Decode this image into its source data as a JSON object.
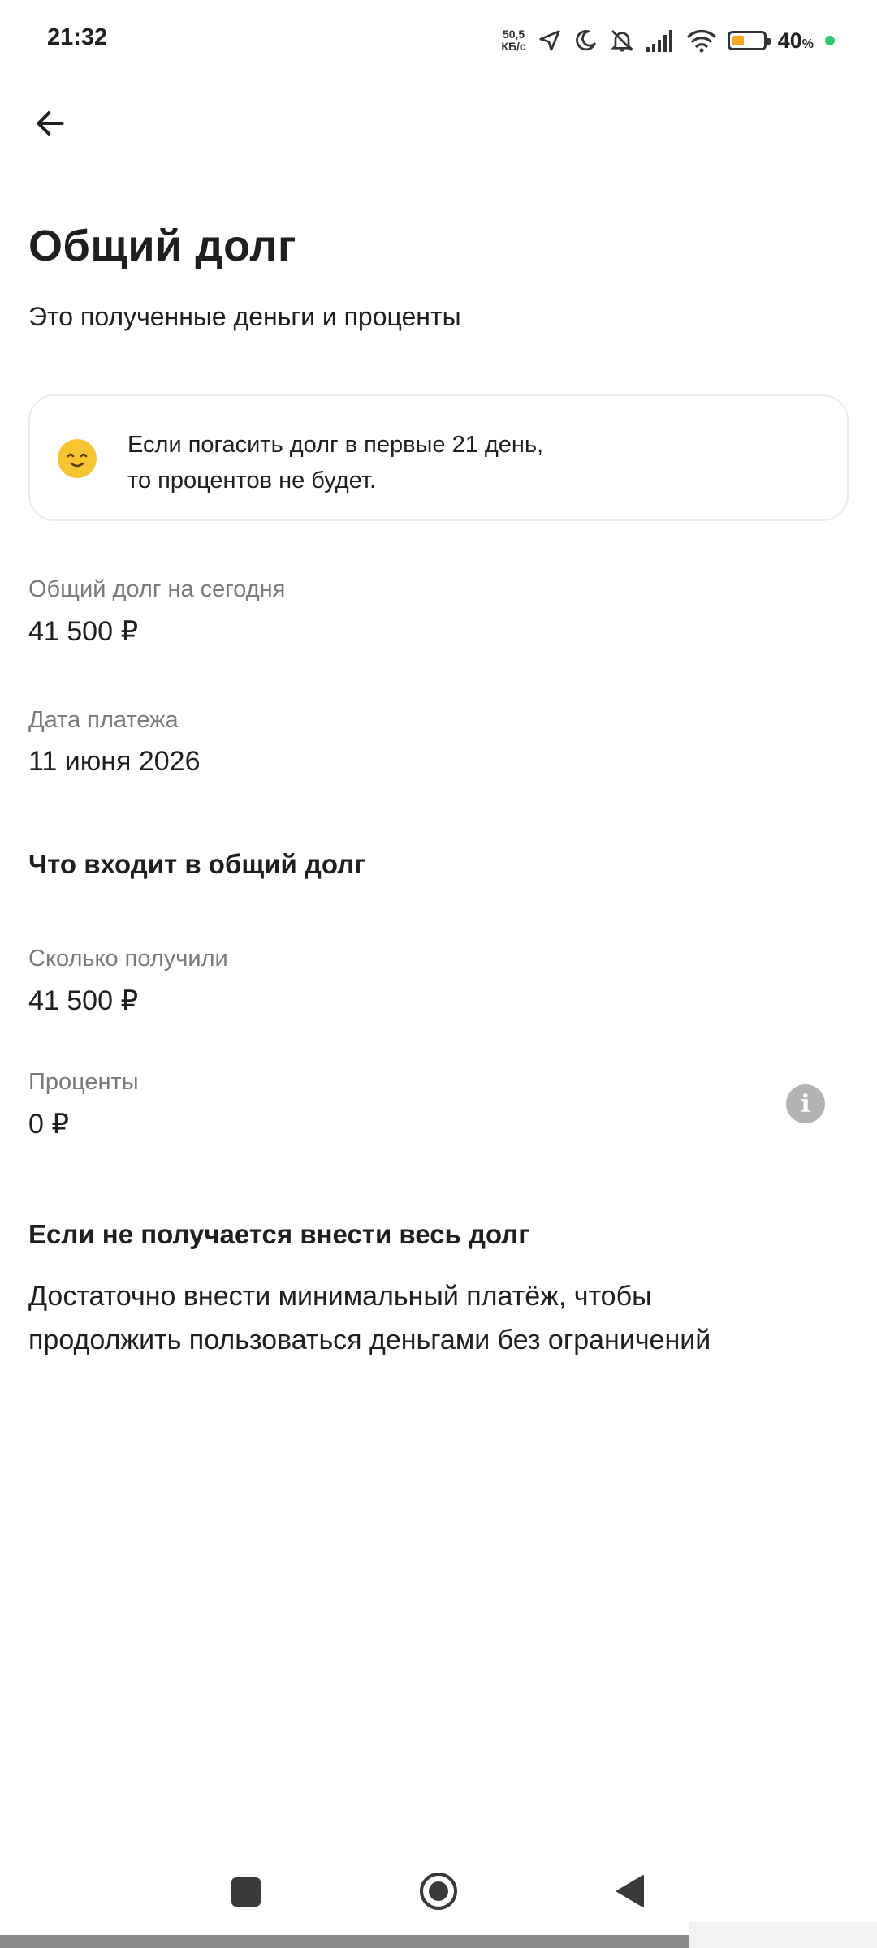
{
  "status_bar": {
    "time": "21:32",
    "net_speed_value": "50,5",
    "net_speed_unit": "КБ/с",
    "battery_percent": "40",
    "battery_percent_sign": "%",
    "icons": [
      "location-arrow-icon",
      "moon-icon",
      "bell-muted-icon",
      "signal-icon",
      "wifi-icon",
      "battery-icon",
      "charging-dot-icon"
    ]
  },
  "header": {
    "back_icon": "arrow-left-icon",
    "title": "Общий долг",
    "subtitle": "Это полученные деньги и проценты"
  },
  "info_card": {
    "icon": "smiley-icon",
    "text_line1": "Если погасить долг в первые 21 день,",
    "text_line2": "то процентов не будет."
  },
  "summary": {
    "total_label": "Общий долг на сегодня",
    "total_value": "41 500 ₽",
    "date_label": "Дата платежа",
    "date_value": "11 июня 2026"
  },
  "breakdown": {
    "heading": "Что входит в общий долг",
    "received_label": "Сколько получили",
    "received_value": "41 500 ₽",
    "interest_label": "Проценты",
    "interest_value": "0 ₽",
    "interest_info_icon": "info-icon"
  },
  "minimum_payment": {
    "heading": "Если не получается внести весь долг",
    "text_line1": "Достаточно внести минимальный платёж, чтобы",
    "text_line2": "продолжить пользоваться деньгами без ограничений"
  },
  "nav_bar": {
    "icons": [
      "recent-apps-icon",
      "home-icon",
      "back-triangle-icon"
    ]
  },
  "colors": {
    "text_primary": "#1f1f1f",
    "text_secondary": "#7a7a7a",
    "card_border": "#ebebeb",
    "smiley": "#f7c531",
    "info_icon": "#b3b3b6"
  }
}
